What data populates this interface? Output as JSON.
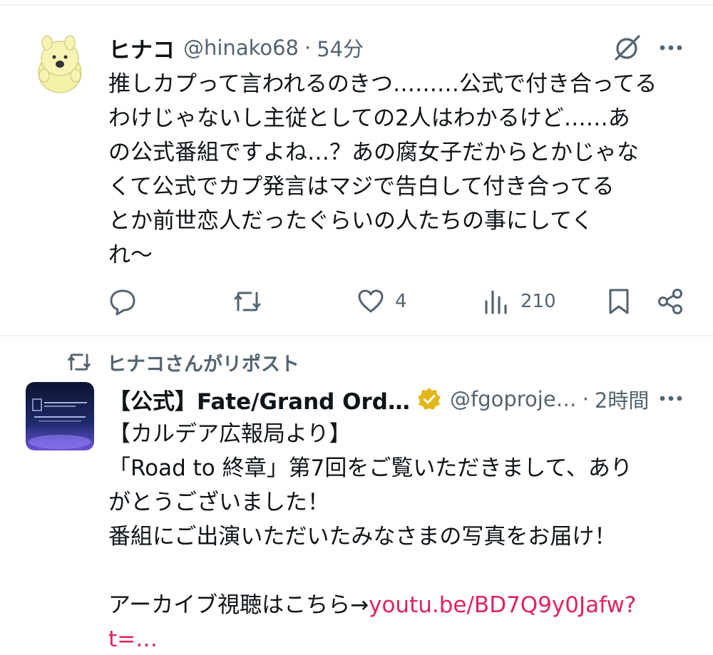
{
  "tweet1": {
    "name": "ヒナコ",
    "handle": "@hinako68",
    "dot": "·",
    "time": "54分",
    "lines": [
      "推しカプって言われるのきつ………公式で付き合ってる",
      "わけじゃないし主従としての2人はわかるけど……あ",
      "の公式番組ですよね…？あの腐女子だからとかじゃな",
      "くて公式でカプ発言はマジで告白して付き合ってる",
      "とか前世恋人だったぐらいの人たちの事にしてく",
      "れ〜"
    ],
    "actions": {
      "reply_count": "",
      "repost_count": "",
      "like_count": "4",
      "views_count": "210"
    }
  },
  "repost_banner": {
    "label": "ヒナコさんがリポスト"
  },
  "tweet2": {
    "name": "【公式】Fate/Grand Ord…",
    "handle": "@fgoproje…",
    "dot": "·",
    "time": "2時間",
    "lines": [
      "【カルデア広報局より】",
      "「Road to 終章」第7回をご覧いただきまして、あり",
      "がとうございました！",
      "番組にご出演いただいたみなさまの写真をお届け！",
      "",
      "アーカイブ視聴はこちら→"
    ],
    "link_text": "youtu.be/BD7Q9y0Jafw?",
    "link_cont": "t=…"
  },
  "icons": {
    "grok": "grok-icon",
    "more": "more-icon",
    "reply": "reply-icon",
    "repost": "repost-icon",
    "like": "heart-icon",
    "views": "views-icon",
    "bookmark": "bookmark-icon",
    "share": "share-icon",
    "verified": "verified-badge-icon"
  },
  "colors": {
    "text": "#0f1419",
    "secondary": "#536471",
    "link": "#e0245e",
    "verified": "#e2b719"
  }
}
